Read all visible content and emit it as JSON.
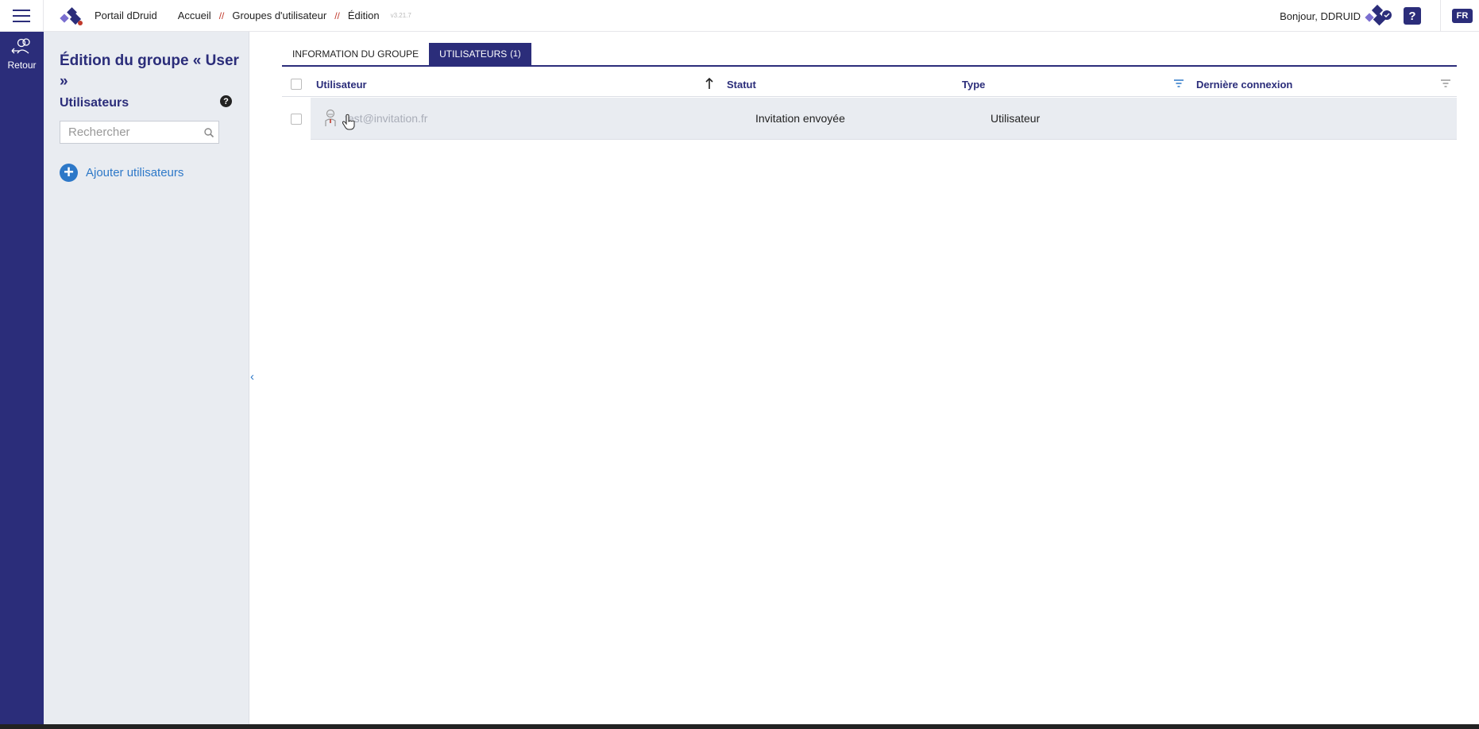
{
  "topbar": {
    "app_name": "Portail dDruid",
    "breadcrumb": [
      "Accueil",
      "Groupes d'utilisateur",
      "Édition"
    ],
    "separator": "//",
    "version": "v3.21.7",
    "greeting": "Bonjour, DDRUID",
    "help_label": "?",
    "lang_label": "FR"
  },
  "rail": {
    "back_label": "Retour"
  },
  "panel": {
    "title": "Édition du groupe « User »",
    "subtitle": "Utilisateurs",
    "help_label": "?",
    "search_placeholder": "Rechercher",
    "add_label": "Ajouter utilisateurs",
    "add_symbol": "+",
    "collapse_symbol": "‹"
  },
  "tabs": [
    {
      "label": "INFORMATION DU GROUPE",
      "count": ""
    },
    {
      "label": "UTILISATEURS",
      "count": "(1)"
    }
  ],
  "table": {
    "columns": [
      "Utilisateur",
      "Statut",
      "Type",
      "Dernière connexion"
    ],
    "rows": [
      {
        "email": "test@invitation.fr",
        "status": "Invitation envoyée",
        "type": "Utilisateur",
        "last_login": ""
      }
    ]
  },
  "colors": {
    "primary": "#2b2d7a",
    "accent": "#2d78c8",
    "panel_bg": "#e9ecf1",
    "breadcrumb_sep": "#c0392b"
  }
}
